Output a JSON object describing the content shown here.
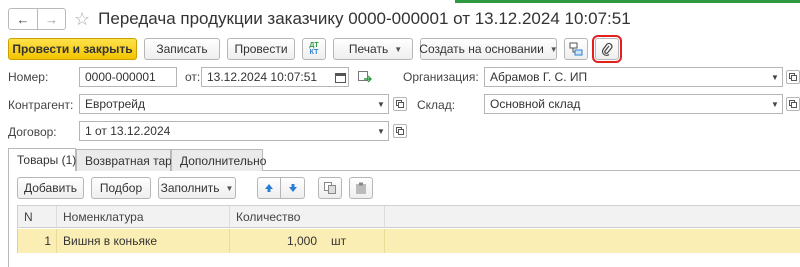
{
  "title": "Передача продукции заказчику 0000-000001 от 13.12.2024 10:07:51",
  "nav": {
    "back_glyph": "←",
    "forward_glyph": "→",
    "star_glyph": "☆"
  },
  "toolbar": {
    "post_close": "Провести и закрыть",
    "save": "Записать",
    "post": "Провести",
    "dtkt_top": "ДТ",
    "dtkt_bottom": "КТ",
    "print": "Печать",
    "create_based": "Создать на основании"
  },
  "form": {
    "number_label": "Номер:",
    "number_value": "0000-000001",
    "date_label": "от:",
    "date_value": "13.12.2024 10:07:51",
    "org_label": "Организация:",
    "org_value": "Абрамов Г. С. ИП",
    "counterparty_label": "Контрагент:",
    "counterparty_value": "Евротрейд",
    "warehouse_label": "Склад:",
    "warehouse_value": "Основной склад",
    "contract_label": "Договор:",
    "contract_value": "1 от 13.12.2024"
  },
  "tabs": [
    {
      "label": "Товары (1)",
      "active": true
    },
    {
      "label": "Возвратная тара",
      "active": false
    },
    {
      "label": "Дополнительно",
      "active": false
    }
  ],
  "table_toolbar": {
    "add": "Добавить",
    "select": "Подбор",
    "fill": "Заполнить"
  },
  "table": {
    "headers": [
      "N",
      "Номенклатура",
      "Количество"
    ],
    "rows": [
      {
        "n": "1",
        "item": "Вишня в коньяке",
        "qty": "1,000",
        "unit": "шт"
      }
    ]
  },
  "colors": {
    "primary": "#f2c300",
    "highlight": "#e32020",
    "row_selected": "#fbeeb4",
    "accent_green": "#2f9a41",
    "arrow_blue": "#2a7fd4"
  }
}
